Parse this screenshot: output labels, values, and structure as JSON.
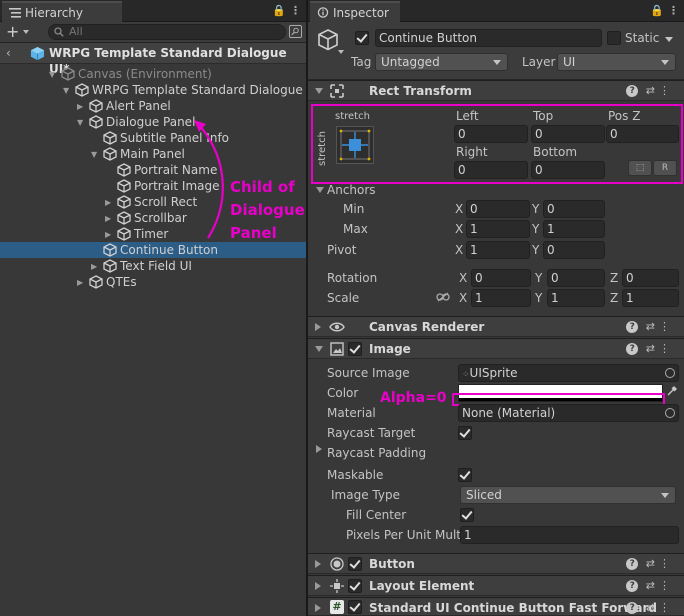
{
  "hierarchy": {
    "tab_title": "Hierarchy",
    "search_placeholder": "All",
    "scene_name": "WRPG Template Standard Dialogue UI*",
    "items": [
      {
        "label": "Canvas (Environment)",
        "indent": 0,
        "fold": "open",
        "dim": true
      },
      {
        "label": "WRPG Template Standard Dialogue UI",
        "indent": 1,
        "fold": "open",
        "dim": false
      },
      {
        "label": "Alert Panel",
        "indent": 2,
        "fold": "closed",
        "dim": false
      },
      {
        "label": "Dialogue Panel",
        "indent": 2,
        "fold": "open",
        "dim": false
      },
      {
        "label": "Subtitle Panel Info",
        "indent": 3,
        "fold": "none",
        "dim": false
      },
      {
        "label": "Main Panel",
        "indent": 3,
        "fold": "open",
        "dim": false
      },
      {
        "label": "Portrait Name",
        "indent": 4,
        "fold": "none",
        "dim": false
      },
      {
        "label": "Portrait Image",
        "indent": 4,
        "fold": "none",
        "dim": false
      },
      {
        "label": "Scroll Rect",
        "indent": 4,
        "fold": "closed",
        "dim": false
      },
      {
        "label": "Scrollbar",
        "indent": 4,
        "fold": "closed",
        "dim": false
      },
      {
        "label": "Timer",
        "indent": 4,
        "fold": "closed",
        "dim": false
      },
      {
        "label": "Continue Button",
        "indent": 3,
        "fold": "none",
        "dim": false,
        "selected": true
      },
      {
        "label": "Text Field UI",
        "indent": 3,
        "fold": "closed",
        "dim": false
      },
      {
        "label": "QTEs",
        "indent": 2,
        "fold": "closed",
        "dim": false
      }
    ],
    "annotation": [
      "Child of",
      "Dialogue",
      "Panel"
    ]
  },
  "inspector": {
    "tab_title": "Inspector",
    "object_name": "Continue Button",
    "static_label": "Static",
    "tag_label": "Tag",
    "tag_value": "Untagged",
    "layer_label": "Layer",
    "layer_value": "UI",
    "rect_transform": {
      "title": "Rect Transform",
      "anchor_preset_h": "stretch",
      "anchor_preset_v": "stretch",
      "left_label": "Left",
      "left": "0",
      "top_label": "Top",
      "top": "0",
      "posz_label": "Pos Z",
      "posz": "0",
      "right_label": "Right",
      "right": "0",
      "bottom_label": "Bottom",
      "bottom": "0",
      "r_button": "R",
      "anchors_label": "Anchors",
      "min_label": "Min",
      "min_x": "0",
      "min_y": "0",
      "max_label": "Max",
      "max_x": "1",
      "max_y": "1",
      "pivot_label": "Pivot",
      "pivot_x": "1",
      "pivot_y": "0",
      "rotation_label": "Rotation",
      "rot_x": "0",
      "rot_y": "0",
      "rot_z": "0",
      "scale_label": "Scale",
      "scale_x": "1",
      "scale_y": "1",
      "scale_z": "1",
      "x": "X",
      "y": "Y",
      "z": "Z"
    },
    "canvas_renderer": {
      "title": "Canvas Renderer"
    },
    "image": {
      "title": "Image",
      "source_label": "Source Image",
      "source_value": "UISprite",
      "color_label": "Color",
      "alpha_note": "Alpha=0",
      "material_label": "Material",
      "material_value": "None (Material)",
      "raycast_target_label": "Raycast Target",
      "raycast_padding_label": "Raycast Padding",
      "maskable_label": "Maskable",
      "image_type_label": "Image Type",
      "image_type_value": "Sliced",
      "fill_center_label": "Fill Center",
      "ppu_label": "Pixels Per Unit Multi",
      "ppu_value": "1"
    },
    "button": {
      "title": "Button"
    },
    "layout_element": {
      "title": "Layout Element"
    },
    "script": {
      "title": "Standard UI Continue Button Fast Forward"
    }
  },
  "colors": {
    "accent_magenta": "#e800c8",
    "selection": "#2c5d87"
  }
}
